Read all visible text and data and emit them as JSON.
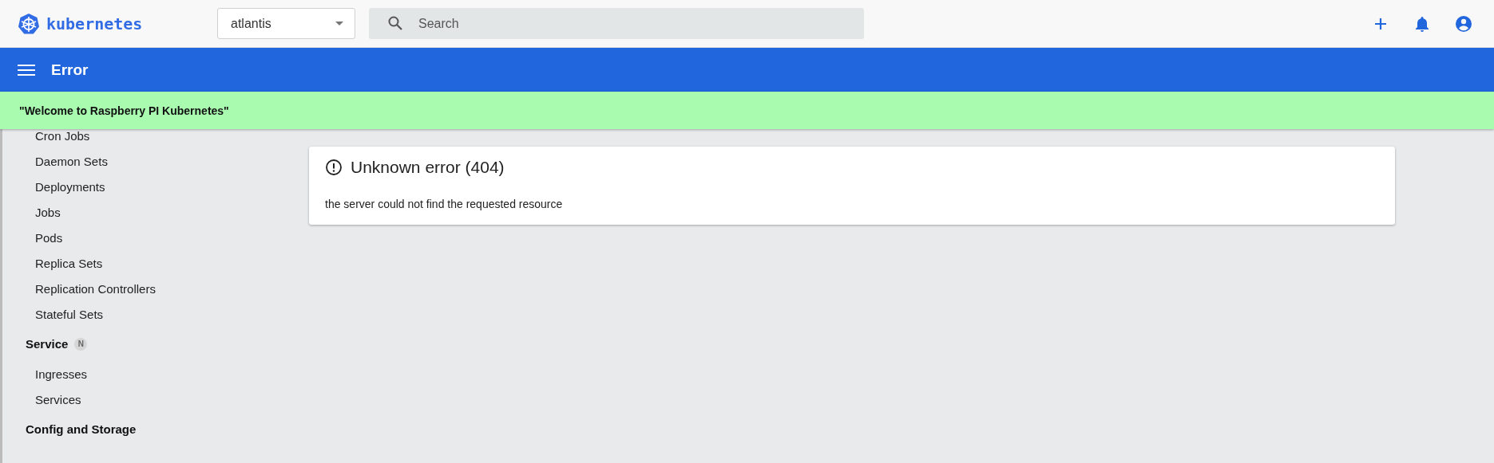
{
  "header": {
    "brand": "kubernetes",
    "namespace": "atlantis",
    "search": {
      "placeholder": "Search"
    }
  },
  "toolbar": {
    "title": "Error"
  },
  "banner": {
    "text": "\"Welcome to Raspberry PI Kubernetes\""
  },
  "sidebar": {
    "items": [
      {
        "kind": "item",
        "label": "Cron Jobs"
      },
      {
        "kind": "item",
        "label": "Daemon Sets"
      },
      {
        "kind": "item",
        "label": "Deployments"
      },
      {
        "kind": "item",
        "label": "Jobs"
      },
      {
        "kind": "item",
        "label": "Pods"
      },
      {
        "kind": "item",
        "label": "Replica Sets"
      },
      {
        "kind": "item",
        "label": "Replication Controllers"
      },
      {
        "kind": "item",
        "label": "Stateful Sets"
      },
      {
        "kind": "section",
        "label": "Service",
        "badge": "N"
      },
      {
        "kind": "item",
        "label": "Ingresses"
      },
      {
        "kind": "item",
        "label": "Services"
      },
      {
        "kind": "section",
        "label": "Config and Storage"
      }
    ]
  },
  "error_card": {
    "title": "Unknown error (404)",
    "message": "the server could not find the requested resource"
  }
}
